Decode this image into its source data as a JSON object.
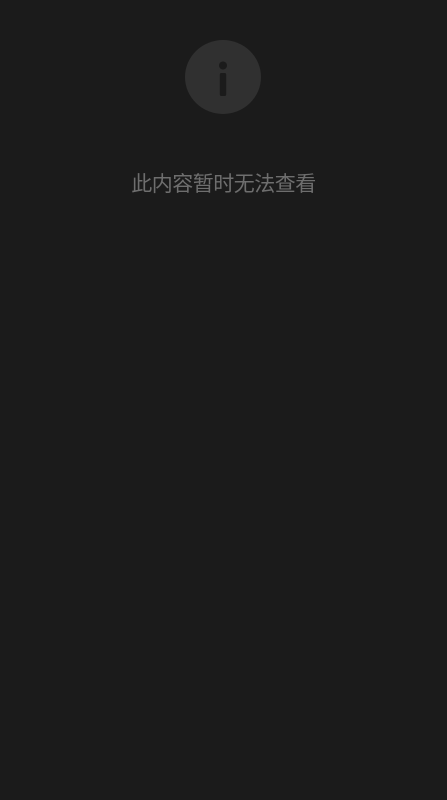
{
  "notice": {
    "icon": "info-icon",
    "message": "此内容暂时无法查看"
  },
  "colors": {
    "background": "#1b1b1b",
    "icon_circle": "#303030",
    "icon_glyph": "#1b1b1b",
    "message_text": "#6e6e6e"
  }
}
